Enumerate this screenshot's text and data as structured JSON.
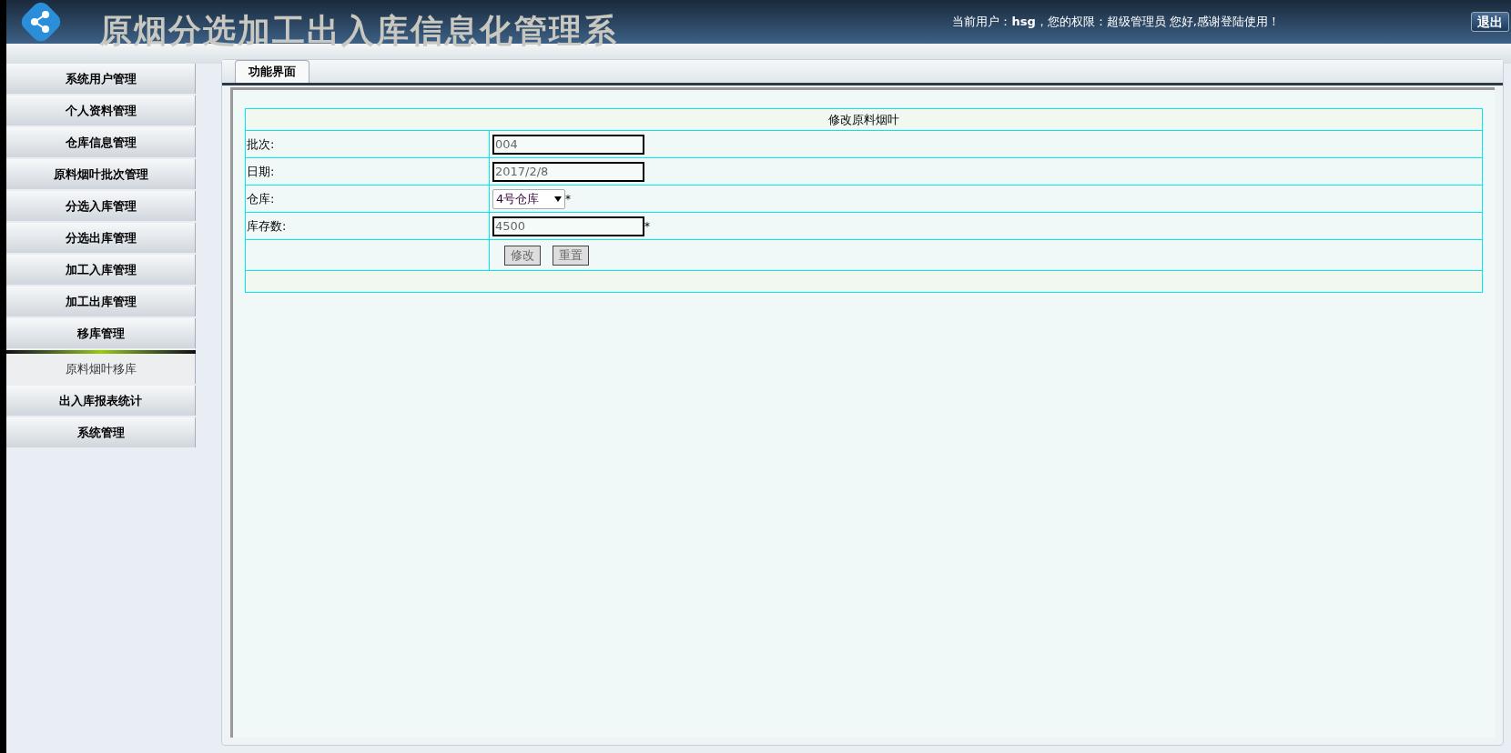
{
  "header": {
    "title": "原烟分选加工出入库信息化管理系",
    "user_label": "当前用户：",
    "user": "hsg",
    "role_label": "，您的权限：超级管理员 您好,感谢登陆使用！",
    "logout": "退出"
  },
  "sidebar": {
    "items": [
      {
        "label": "系统用户管理",
        "kind": "group"
      },
      {
        "label": "个人资料管理",
        "kind": "group"
      },
      {
        "label": "仓库信息管理",
        "kind": "group"
      },
      {
        "label": "原料烟叶批次管理",
        "kind": "group"
      },
      {
        "label": "分选入库管理",
        "kind": "group"
      },
      {
        "label": "分选出库管理",
        "kind": "group"
      },
      {
        "label": "加工入库管理",
        "kind": "group"
      },
      {
        "label": "加工出库管理",
        "kind": "group"
      },
      {
        "label": "移库管理",
        "kind": "group",
        "expanded": true
      },
      {
        "label": "原料烟叶移库",
        "kind": "sub"
      },
      {
        "label": "出入库报表统计",
        "kind": "group"
      },
      {
        "label": "系统管理",
        "kind": "group"
      }
    ]
  },
  "tabs": [
    {
      "label": "功能界面",
      "selected": true
    }
  ],
  "form": {
    "title": "修改原料烟叶",
    "fields": [
      {
        "label": "批次:",
        "kind": "text",
        "value": "004"
      },
      {
        "label": "日期:",
        "kind": "text",
        "value": "2017/2/8"
      },
      {
        "label": "仓库:",
        "kind": "select",
        "value": "4号仓库",
        "required": "*"
      },
      {
        "label": "库存数:",
        "kind": "text",
        "value": "4500",
        "required": "*"
      }
    ],
    "buttons": [
      "修改",
      "重置"
    ]
  }
}
